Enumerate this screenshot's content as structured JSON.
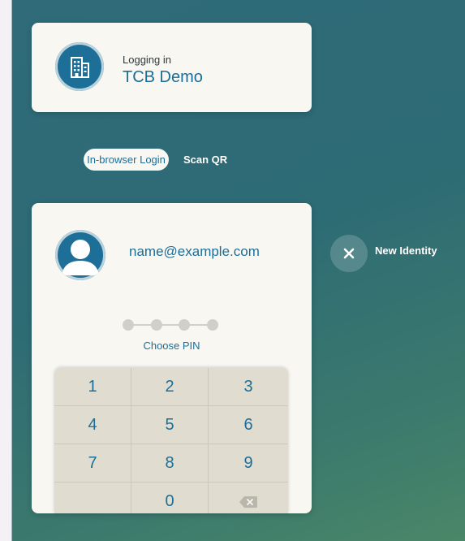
{
  "login": {
    "status_label": "Logging in",
    "org_name": "TCB Demo",
    "org_icon": "building-icon"
  },
  "tabs": [
    {
      "label": "In-browser Login",
      "active": true
    },
    {
      "label": "Scan QR",
      "active": false
    }
  ],
  "identity": {
    "email": "name@example.com",
    "avatar_icon": "user-avatar-icon",
    "pin_length": 4,
    "pin_entered": 0,
    "pin_prompt": "Choose PIN"
  },
  "keypad": {
    "keys": [
      "1",
      "2",
      "3",
      "4",
      "5",
      "6",
      "7",
      "8",
      "9",
      "",
      "0"
    ],
    "backspace_icon": "backspace-icon"
  },
  "new_identity": {
    "label": "New Identity",
    "icon": "close-icon"
  },
  "colors": {
    "accent": "#1c6e98",
    "card": "#f8f7f2",
    "background": "#2f6b79",
    "keypad": "#e0ddd0"
  }
}
